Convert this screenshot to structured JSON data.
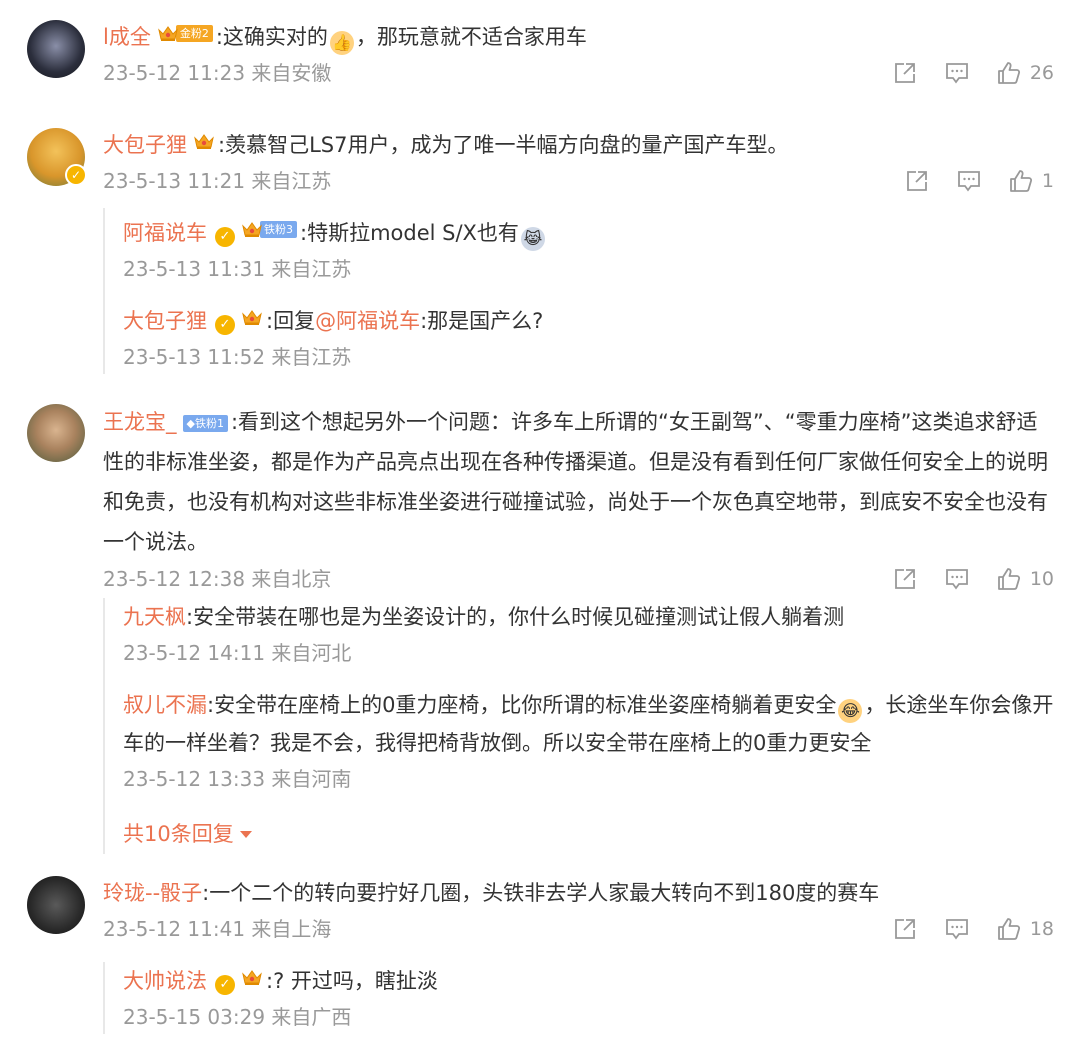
{
  "comments": [
    {
      "user": "l成全",
      "fan_badge": "金粉2",
      "text": ":这确实对的",
      "text_after": "，那玩意就不适合家用车",
      "emoji": "thumbs-up-emoji",
      "time": "23-5-12 11:23 来自安徽",
      "likes": "26"
    },
    {
      "user": "大包子狸",
      "text": ":羡慕智己LS7用户，成为了唯一半幅方向盘的量产国产车型。",
      "time": "23-5-13 11:21 来自江苏",
      "likes": "1",
      "replies": [
        {
          "user": "阿福说车",
          "fan_badge": "铁粉3",
          "text": ":特斯拉model S/X也有",
          "time": "23-5-13 11:31 来自江苏"
        },
        {
          "user": "大包子狸",
          "text_prefix": ":回复",
          "mention": "@阿福说车",
          "text": ":那是国产么?",
          "time": "23-5-13 11:52 来自江苏"
        }
      ]
    },
    {
      "user": "王龙宝_",
      "fan_badge": "铁粉1",
      "text": ":看到这个想起另外一个问题：许多车上所谓的“女王副驾”、“零重力座椅”这类追求舒适性的非标准坐姿，都是作为产品亮点出现在各种传播渠道。但是没有看到任何厂家做任何安全上的说明和免责，也没有机构对这些非标准坐姿进行碰撞试验，尚处于一个灰色真空地带，到底安不安全也没有一个说法。",
      "time": "23-5-12 12:38 来自北京",
      "likes": "10",
      "replies": [
        {
          "user": "九天枫",
          "text": ":安全带装在哪也是为坐姿设计的，你什么时候见碰撞测试让假人躺着测",
          "time": "23-5-12 14:11 来自河北"
        },
        {
          "user": "叔儿不漏",
          "text": ":安全带在座椅上的0重力座椅，比你所谓的标准坐姿座椅躺着更安全",
          "text_after": "，长途坐车你会像开车的一样坐着？我是不会，我得把椅背放倒。所以安全带在座椅上的0重力更安全",
          "time": "23-5-12 13:33 来自河南"
        }
      ],
      "more_replies": "共10条回复"
    },
    {
      "user": "玲珑--骰子",
      "text": ":一个二个的转向要拧好几圈，头铁非去学人家最大转向不到180度的赛车",
      "time": "23-5-12 11:41 来自上海",
      "likes": "18",
      "replies": [
        {
          "user": "大帅说法",
          "text": ":? 开过吗，瞎扯淡",
          "time": "23-5-15 03:29 来自广西"
        }
      ]
    }
  ],
  "colors": {
    "username": "#eb7350",
    "meta": "#999999",
    "text": "#333333",
    "verified": "#f7b500"
  }
}
